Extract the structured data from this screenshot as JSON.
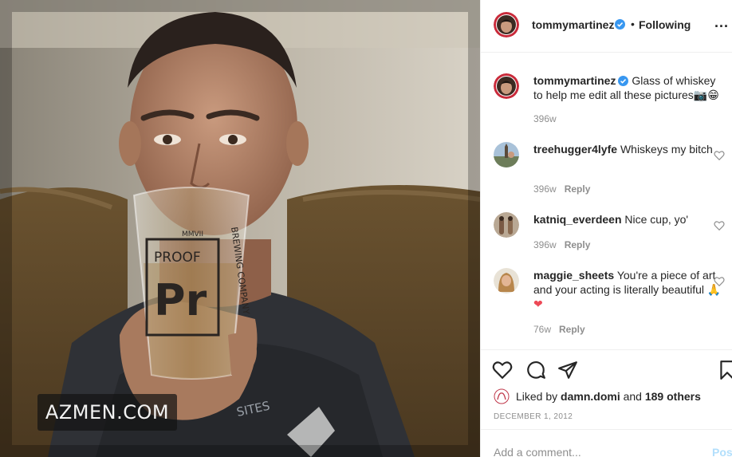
{
  "photo": {
    "watermark": "AZMEN.COM",
    "glass_text": {
      "brand": "PROOF",
      "logo": "Pr",
      "roman": "MMVII",
      "side": "BREWING COMPANY"
    },
    "shirt_text": "SITES"
  },
  "header": {
    "username": "tommymartinez",
    "separator": "•",
    "follow_status": "Following",
    "more": "..."
  },
  "caption": {
    "username": "tommymartinez",
    "text": "Glass of whiskey to help me edit all these pictures",
    "emoji": "📷😁",
    "age": "396w"
  },
  "comments": [
    {
      "username": "treehugger4lyfe",
      "text": "Whiskeys my bitch",
      "age": "396w",
      "reply": "Reply"
    },
    {
      "username": "katniq_everdeen",
      "text": "Nice cup, yo'",
      "age": "396w",
      "reply": "Reply"
    },
    {
      "username": "maggie_sheets",
      "text": "You're a piece of art and your acting is literally beautiful",
      "emoji": "🙏",
      "heart": "❤",
      "age": "76w",
      "reply": "Reply"
    }
  ],
  "likes": {
    "prefix": "Liked by",
    "user": "damn.domi",
    "joiner": "and",
    "others": "189 others"
  },
  "post_date": "DECEMBER 1, 2012",
  "add_comment": {
    "placeholder": "Add a comment...",
    "post_label": "Post"
  },
  "colors": {
    "verified": "#3897f0",
    "post_disabled": "#b2dffc",
    "muted": "#8e8e8e"
  }
}
